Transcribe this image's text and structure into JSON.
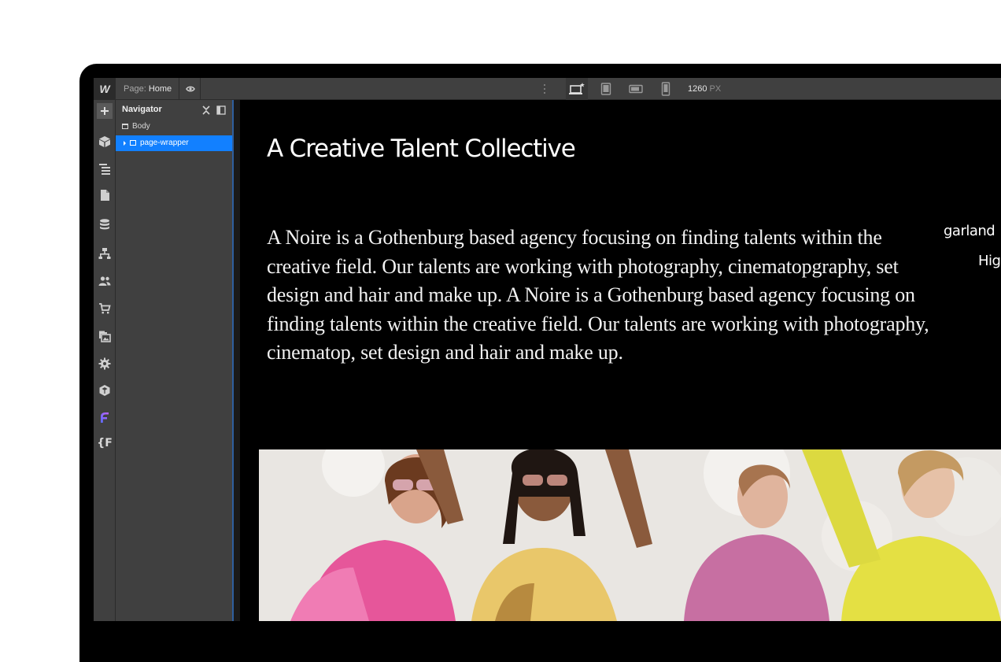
{
  "app": {
    "logo": "W",
    "page_prefix": "Page:",
    "page_name": "Home",
    "width_value": "1260",
    "width_unit": "PX"
  },
  "icons": {
    "topbar": [
      "eye-icon",
      "more-icon",
      "desktop-star-icon",
      "tablet-icon",
      "mobile-landscape-icon",
      "mobile-portrait-icon"
    ],
    "rail": [
      "add-icon",
      "symbols-icon",
      "navigator-icon",
      "pages-icon",
      "cms-icon",
      "logic-icon",
      "users-icon",
      "ecommerce-icon",
      "assets-icon",
      "settings-icon",
      "apps-icon",
      "finsweet-icon",
      "fonts-icon"
    ]
  },
  "navigator": {
    "title": "Navigator",
    "items": [
      {
        "label": "Body"
      },
      {
        "label": "page-wrapper",
        "selected": true
      }
    ]
  },
  "canvas": {
    "headline": "A Creative Talent Collective",
    "body": "A Noire is a Gothenburg based agency focusing on finding talents within the creative field. Our talents are working with photography, cinematopgraphy, set design and hair and make up. A Noire is a Gothenburg based agency focusing on finding talents within the creative field. Our talents are working with photography, cinematop, set design and hair and make up.",
    "side_text_1": "garland",
    "side_text_2": "Hig"
  },
  "colors": {
    "accent": "#1280ff",
    "panel": "#404040",
    "canvas_bg": "#000000"
  }
}
